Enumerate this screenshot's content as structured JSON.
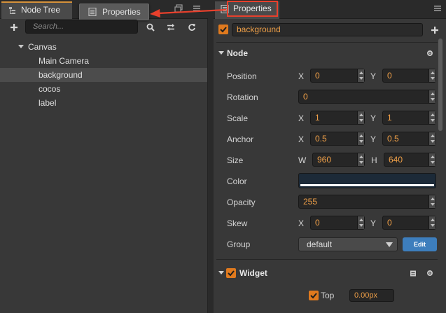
{
  "left": {
    "tab_label": "Node Tree",
    "ghost_tab_label": "Properties",
    "search_placeholder": "Search...",
    "tree": [
      {
        "label": "Canvas"
      },
      {
        "label": "Main Camera"
      },
      {
        "label": "background",
        "selected": true
      },
      {
        "label": "cocos"
      },
      {
        "label": "label"
      }
    ]
  },
  "right": {
    "tab_label": "Properties",
    "node_name": "background",
    "node_section": "Node",
    "props": {
      "position": {
        "label": "Position",
        "x_label": "X",
        "x": "0",
        "y_label": "Y",
        "y": "0"
      },
      "rotation": {
        "label": "Rotation",
        "value": "0"
      },
      "scale": {
        "label": "Scale",
        "x_label": "X",
        "x": "1",
        "y_label": "Y",
        "y": "1"
      },
      "anchor": {
        "label": "Anchor",
        "x_label": "X",
        "x": "0.5",
        "y_label": "Y",
        "y": "0.5"
      },
      "size": {
        "label": "Size",
        "w_label": "W",
        "w": "960",
        "h_label": "H",
        "h": "640"
      },
      "color": {
        "label": "Color",
        "value": "#1c2a38"
      },
      "opacity": {
        "label": "Opacity",
        "value": "255"
      },
      "skew": {
        "label": "Skew",
        "x_label": "X",
        "x": "0",
        "y_label": "Y",
        "y": "0"
      },
      "group": {
        "label": "Group",
        "value": "default",
        "edit_label": "Edit"
      }
    },
    "widget": {
      "label": "Widget",
      "top_label": "Top",
      "top_value": "0.00px"
    }
  },
  "colors": {
    "accent": "#e07a1e",
    "value_text": "#f0a048",
    "highlight": "#e8402c",
    "edit_button": "#3d7ebd"
  },
  "icons": [
    "tree-icon",
    "properties-icon",
    "maximize-icon",
    "menu-icon",
    "add-icon",
    "search-icon",
    "swap-icon",
    "refresh-icon",
    "check-icon",
    "gear-icon",
    "clipboard-icon",
    "caret-icon"
  ]
}
